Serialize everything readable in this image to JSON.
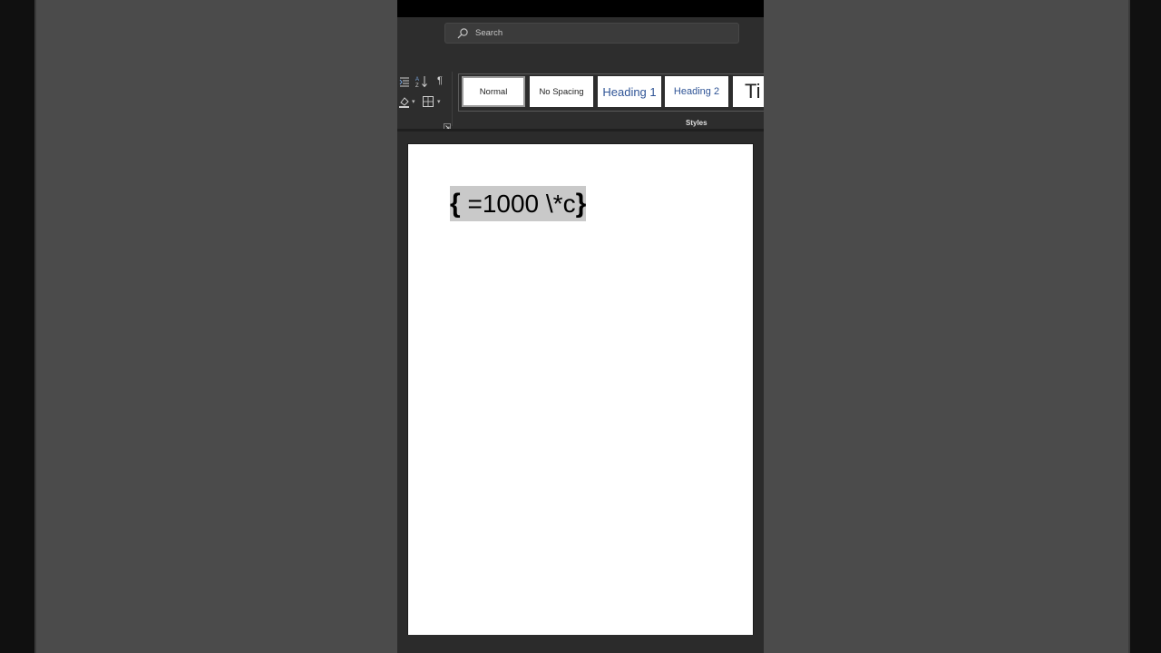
{
  "search": {
    "placeholder": "Search"
  },
  "ribbon": {
    "paragraph_tools": [
      {
        "icon": "multilevel-list-icon"
      },
      {
        "icon": "sort-icon"
      },
      {
        "icon": "show-formatting-marks-icon",
        "glyph": "¶"
      },
      {
        "icon": "shading-icon"
      },
      {
        "icon": "borders-icon"
      }
    ],
    "styles": {
      "group_label": "Styles",
      "items": [
        {
          "label": "Normal",
          "selected": true
        },
        {
          "label": "No Spacing",
          "selected": false
        },
        {
          "label": "Heading 1",
          "selected": false
        },
        {
          "label": "Heading 2",
          "selected": false
        },
        {
          "label": "Ti",
          "selected": false
        }
      ]
    }
  },
  "document": {
    "field_open": "{",
    "field_body": " =1000 \\*c",
    "field_close": "}"
  },
  "colors": {
    "background": "#4b4b4b",
    "ribbon": "#2d2d2d",
    "heading_accent": "#2f5496",
    "field_shading": "#c9c9c9"
  }
}
